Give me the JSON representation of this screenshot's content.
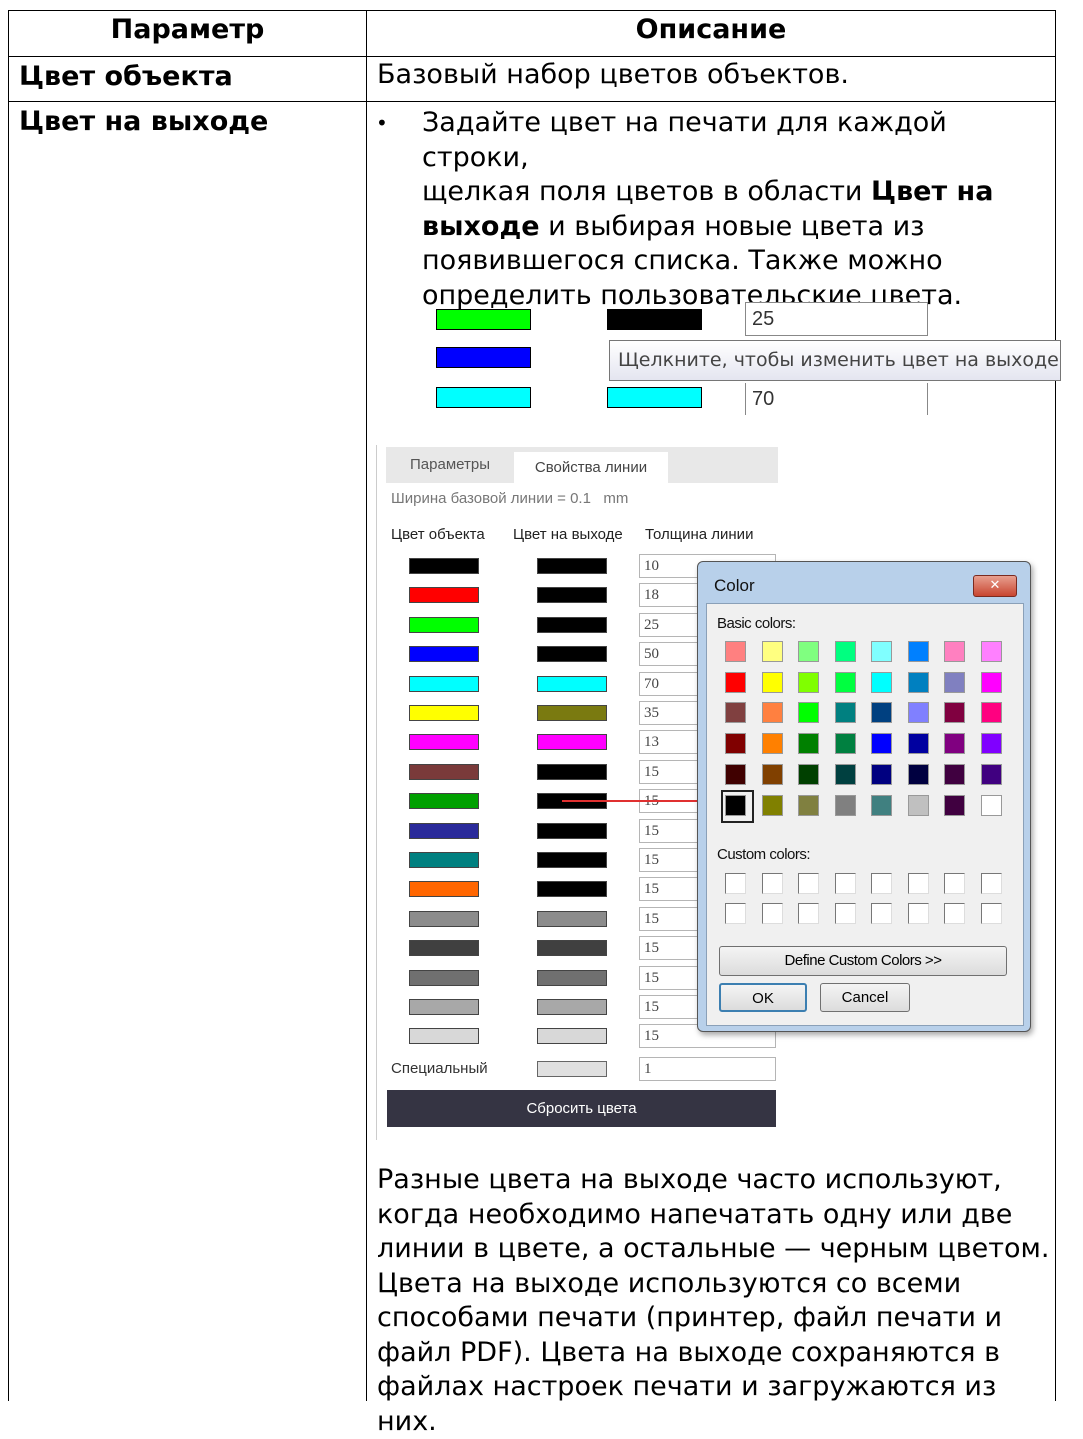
{
  "table": {
    "headers": [
      "Параметр",
      "Описание"
    ],
    "row1": {
      "param": "Цвет объекта",
      "desc": "Базовый набор цветов объектов."
    },
    "row2": {
      "param": "Цвет на выходе",
      "bullet": "•",
      "line1": "Задайте цвет на печати для каждой строки,",
      "line2_a": "щелкая поля цветов в области ",
      "line2_b": "Цвет на",
      "line3_a": "выходе",
      "line3_b": " и выбирая новые цвета из",
      "line4": "появившегося списка. Также можно",
      "line5": "определить пользовательские цвета.",
      "para": [
        "Разные цвета на выходе часто используют,",
        "когда необходимо напечатать одну или две",
        "линии в цвете, а остальные — черным цветом.",
        "Цвета на выходе используются со всеми",
        "способами печати (принтер, файл печати и",
        "файл PDF). Цвета на выходе сохраняются в",
        "файлах настроек печати и загружаются из них."
      ]
    }
  },
  "snippet": {
    "value_top": "25",
    "tooltip": "Щелкните, чтобы изменить цвет на выходе",
    "value_bottom": "70",
    "colors": {
      "green": "#00ff00",
      "black": "#000000",
      "blue": "#0000ff",
      "cyan": "#00ffff"
    }
  },
  "settings_panel": {
    "tabs": [
      "Параметры",
      "Свойства линии"
    ],
    "base_width": "Ширина базовой линии = 0.1   mm",
    "col_headers": [
      "Цвет объекта",
      "Цвет на выходе",
      "Толщина линии"
    ],
    "rows": [
      {
        "obj": "#000000",
        "out": "#000000",
        "w": "10"
      },
      {
        "obj": "#ff0000",
        "out": "#000000",
        "w": "18"
      },
      {
        "obj": "#00ff00",
        "out": "#000000",
        "w": "25"
      },
      {
        "obj": "#0000ff",
        "out": "#000000",
        "w": "50"
      },
      {
        "obj": "#00ffff",
        "out": "#00ffff",
        "w": "70"
      },
      {
        "obj": "#ffff00",
        "out": "#7a7a10",
        "w": "35"
      },
      {
        "obj": "#ff00ff",
        "out": "#ff00ff",
        "w": "13"
      },
      {
        "obj": "#7a3a3a",
        "out": "#000000",
        "w": "15"
      },
      {
        "obj": "#00a000",
        "out": "#000000",
        "w": "15"
      },
      {
        "obj": "#2a2a9a",
        "out": "#000000",
        "w": "15"
      },
      {
        "obj": "#008080",
        "out": "#000000",
        "w": "15"
      },
      {
        "obj": "#ff6600",
        "out": "#000000",
        "w": "15"
      },
      {
        "obj": "#8c8c8c",
        "out": "#8c8c8c",
        "w": "15"
      },
      {
        "obj": "#404040",
        "out": "#404040",
        "w": "15"
      },
      {
        "obj": "#707070",
        "out": "#707070",
        "w": "15"
      },
      {
        "obj": "#a8a8a8",
        "out": "#a8a8a8",
        "w": "15"
      },
      {
        "obj": "#d8d8d8",
        "out": "#d8d8d8",
        "w": "15"
      }
    ],
    "special_label": "Специальный",
    "special": {
      "out": "#e0e0e0",
      "w": "1"
    },
    "reset_button": "Сбросить цвета"
  },
  "color_dialog": {
    "title": "Color",
    "close_glyph": "✕",
    "basic_label": "Basic colors:",
    "basic_colors": [
      [
        "#ff8080",
        "#ffff80",
        "#80ff80",
        "#00ff80",
        "#80ffff",
        "#0080ff",
        "#ff80c0",
        "#ff80ff"
      ],
      [
        "#ff0000",
        "#ffff00",
        "#80ff00",
        "#00ff40",
        "#00ffff",
        "#0080c0",
        "#8080c0",
        "#ff00ff"
      ],
      [
        "#804040",
        "#ff8040",
        "#00ff00",
        "#008080",
        "#004080",
        "#8080ff",
        "#800040",
        "#ff0080"
      ],
      [
        "#800000",
        "#ff8000",
        "#008000",
        "#008040",
        "#0000ff",
        "#0000a0",
        "#800080",
        "#8000ff"
      ],
      [
        "#400000",
        "#804000",
        "#004000",
        "#004040",
        "#000080",
        "#000040",
        "#400040",
        "#400080"
      ],
      [
        "#000000",
        "#808000",
        "#808040",
        "#808080",
        "#408080",
        "#c0c0c0",
        "#400040",
        "#ffffff"
      ]
    ],
    "custom_label": "Custom colors:",
    "define_button": "Define Custom Colors >>",
    "ok_button": "OK",
    "cancel_button": "Cancel"
  }
}
